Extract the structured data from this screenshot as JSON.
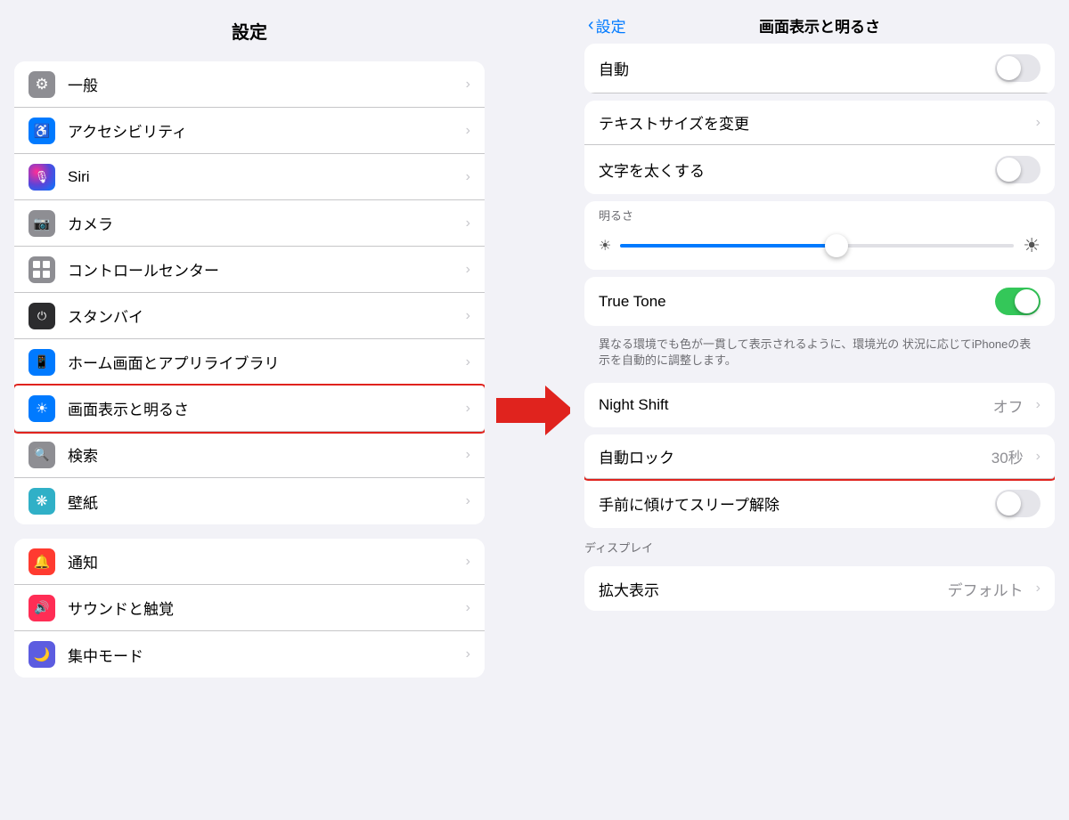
{
  "left_panel": {
    "title": "設定",
    "groups": [
      {
        "id": "group1",
        "items": [
          {
            "id": "general",
            "label": "一般",
            "icon": "⚙️",
            "icon_bg": "bg-gray",
            "icon_text": "⚙"
          },
          {
            "id": "accessibility",
            "label": "アクセシビリティ",
            "icon": "♿",
            "icon_bg": "bg-blue",
            "icon_text": "♿"
          },
          {
            "id": "siri",
            "label": "Siri",
            "icon": "🎙",
            "icon_bg": "bg-pink",
            "icon_text": "🎙"
          },
          {
            "id": "camera",
            "label": "カメラ",
            "icon": "📷",
            "icon_bg": "bg-gray",
            "icon_text": "📷"
          },
          {
            "id": "control_center",
            "label": "コントロールセンター",
            "icon": "⊞",
            "icon_bg": "bg-gray",
            "icon_text": "⊞"
          },
          {
            "id": "standby",
            "label": "スタンバイ",
            "icon": "⏻",
            "icon_bg": "bg-dark",
            "icon_text": "⏻"
          },
          {
            "id": "home_screen",
            "label": "ホーム画面とアプリライブラリ",
            "icon": "📱",
            "icon_bg": "bg-blue",
            "icon_text": "📱"
          },
          {
            "id": "display",
            "label": "画面表示と明るさ",
            "icon": "☀",
            "icon_bg": "bg-blue",
            "icon_text": "☀",
            "highlighted": true
          },
          {
            "id": "search",
            "label": "検索",
            "icon": "🔍",
            "icon_bg": "bg-gray",
            "icon_text": "🔍"
          },
          {
            "id": "wallpaper",
            "label": "壁紙",
            "icon": "❋",
            "icon_bg": "bg-teal",
            "icon_text": "❋"
          }
        ]
      },
      {
        "id": "group2",
        "items": [
          {
            "id": "notifications",
            "label": "通知",
            "icon": "🔔",
            "icon_bg": "bg-red",
            "icon_text": "🔔"
          },
          {
            "id": "sounds",
            "label": "サウンドと触覚",
            "icon": "🔊",
            "icon_bg": "bg-pink",
            "icon_text": "🔊"
          },
          {
            "id": "focus",
            "label": "集中モード",
            "icon": "🌙",
            "icon_bg": "bg-indigo",
            "icon_text": "🌙"
          }
        ]
      }
    ]
  },
  "arrow": {
    "color": "#e0231e"
  },
  "right_panel": {
    "back_label": "設定",
    "title": "画面表示と明るさ",
    "top_partial_label": "自動",
    "sections": [
      {
        "id": "text_section",
        "items": [
          {
            "id": "text_size",
            "label": "テキストサイズを変更",
            "type": "chevron",
            "value": ""
          },
          {
            "id": "bold_text",
            "label": "文字を太くする",
            "type": "toggle",
            "toggle_state": "off"
          }
        ]
      },
      {
        "id": "brightness_section",
        "section_label": "明るさ",
        "brightness_percent": 55
      },
      {
        "id": "true_tone_section",
        "items": [
          {
            "id": "true_tone",
            "label": "True Tone",
            "type": "toggle",
            "toggle_state": "on"
          }
        ],
        "description": "異なる環境でも色が一貫して表示されるように、環境光の\n状況に応じてiPhoneの表示を自動的に調整します。"
      },
      {
        "id": "night_shift_section",
        "items": [
          {
            "id": "night_shift",
            "label": "Night Shift",
            "type": "chevron",
            "value": "オフ"
          }
        ]
      },
      {
        "id": "auto_lock_section",
        "items": [
          {
            "id": "auto_lock",
            "label": "自動ロック",
            "type": "chevron",
            "value": "30秒",
            "highlighted": true
          },
          {
            "id": "raise_to_wake",
            "label": "手前に傾けてスリープ解除",
            "type": "toggle",
            "toggle_state": "off"
          }
        ]
      },
      {
        "id": "display_section",
        "section_label": "ディスプレイ",
        "items": [
          {
            "id": "display_zoom",
            "label": "拡大表示",
            "type": "chevron",
            "value": "デフォルト"
          }
        ]
      }
    ]
  },
  "icons": {
    "chevron_right": "›",
    "chevron_left": "‹"
  }
}
